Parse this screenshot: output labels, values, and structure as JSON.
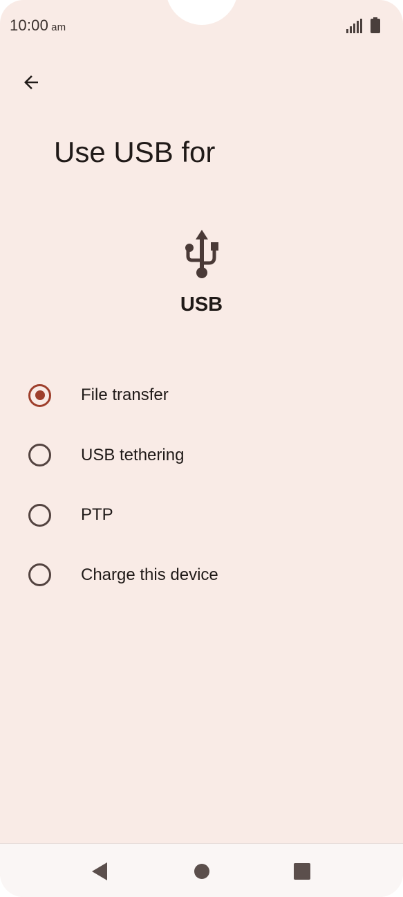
{
  "status_bar": {
    "time": "10:00",
    "ampm": "am",
    "icons": [
      "signal-icon",
      "battery-icon"
    ]
  },
  "header": {
    "back_icon": "arrow-back-icon",
    "title": "Use USB for"
  },
  "usb": {
    "icon": "usb-icon",
    "label": "USB"
  },
  "options": [
    {
      "label": "File transfer",
      "selected": true
    },
    {
      "label": "USB tethering",
      "selected": false
    },
    {
      "label": "PTP",
      "selected": false
    },
    {
      "label": "Charge this device",
      "selected": false
    }
  ],
  "nav_bar": {
    "icons": [
      "nav-back-icon",
      "nav-home-icon",
      "nav-recents-icon"
    ]
  },
  "colors": {
    "background": "#f9ebe6",
    "accent": "#9e3f2c",
    "text": "#201a18"
  }
}
